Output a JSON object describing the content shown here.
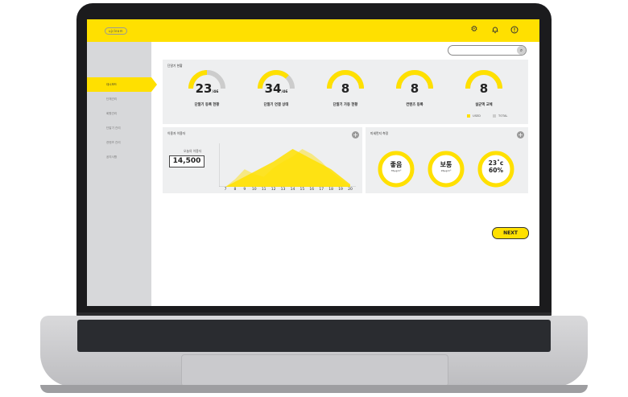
{
  "app": {
    "logo_text": "ujcleam"
  },
  "header": {
    "icons": [
      "gear-icon",
      "bell-icon",
      "alert-icon"
    ]
  },
  "search": {
    "placeholder": ""
  },
  "sidebar": {
    "items": [
      {
        "label": "대시보드",
        "active": true
      },
      {
        "label": "단체관리",
        "active": false
      },
      {
        "label": "회원관리",
        "active": false
      },
      {
        "label": "단말기 관리",
        "active": false
      },
      {
        "label": "컨텐츠 관리",
        "active": false
      },
      {
        "label": "공지사항",
        "active": false
      }
    ]
  },
  "terminal_status": {
    "title": "단말기 현황",
    "gauges": [
      {
        "value": "23",
        "total": "/46",
        "label": "단말기 등록 현황",
        "fraction": 0.5
      },
      {
        "value": "34",
        "total": "/46",
        "label": "단말기 연결 상태",
        "fraction": 0.74
      },
      {
        "value": "8",
        "total": "",
        "label": "단말기 가동 현황",
        "fraction": 1.0
      },
      {
        "value": "8",
        "total": "",
        "label": "컨텐츠 등록",
        "fraction": 1.0
      },
      {
        "value": "8",
        "total": "",
        "label": "살균액 교체",
        "fraction": 1.0
      }
    ],
    "legend": {
      "used": "USED",
      "total": "TOTAL"
    }
  },
  "visitors": {
    "title": "이용자 이용자",
    "today_label": "오늘의 이용자",
    "today_value": "14,500",
    "chart_data": {
      "type": "area",
      "x": [
        "7",
        "8",
        "9",
        "10",
        "11",
        "12",
        "13",
        "14",
        "15",
        "16",
        "17",
        "18",
        "19",
        "20"
      ],
      "series": [
        {
          "values": [
            0,
            4,
            8,
            12,
            16,
            20,
            25,
            30,
            26,
            22,
            18,
            14,
            8,
            2
          ]
        },
        {
          "values": [
            0,
            6,
            14,
            10,
            8,
            15,
            20,
            24,
            30,
            26,
            20,
            12,
            6,
            1
          ]
        }
      ]
    }
  },
  "air_quality": {
    "title": "미세먼지 측정",
    "items": [
      {
        "main": "좋음",
        "sub": "35μg/m³"
      },
      {
        "main": "보통",
        "sub": "26μg/m³"
      },
      {
        "main": "23˚c",
        "sub": "60%"
      }
    ]
  },
  "next_button": "NEXT",
  "colors": {
    "accent": "#ffe000",
    "gauge_bg": "#cccccc",
    "panel_bg": "#eeeff0",
    "sidebar_bg": "#d7d8da"
  }
}
